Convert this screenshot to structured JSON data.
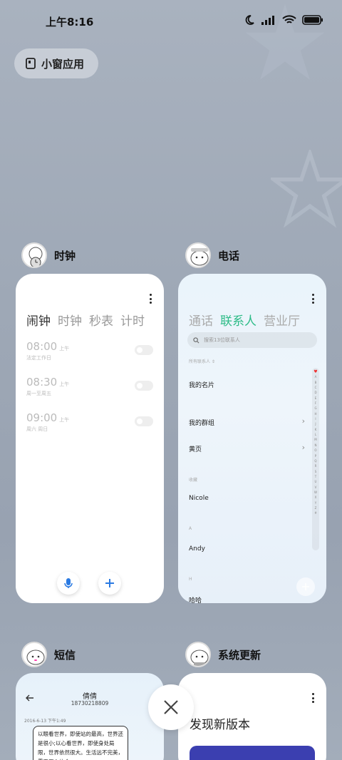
{
  "status": {
    "time": "上午8:16"
  },
  "floating_btn": {
    "label": "小窗应用"
  },
  "apps": [
    {
      "name": "时钟"
    },
    {
      "name": "电话"
    },
    {
      "name": "短信"
    },
    {
      "name": "系统更新"
    }
  ],
  "clock": {
    "tabs": [
      "闹钟",
      "时钟",
      "秒表",
      "计时"
    ],
    "alarms": [
      {
        "time": "08:00",
        "ampm": "上午",
        "desc": "法定工作日"
      },
      {
        "time": "08:30",
        "ampm": "上午",
        "desc": "周一至周五"
      },
      {
        "time": "09:00",
        "ampm": "上午",
        "desc": "周六 周日"
      }
    ]
  },
  "phone": {
    "tabs": [
      "通话",
      "联系人",
      "营业厅"
    ],
    "search_placeholder": "搜索13位联系人",
    "filter": "所有联系人",
    "my_card": "我的名片",
    "groups": "我的群组",
    "yellow": "黄页",
    "fav_header": "收藏",
    "fav1": "Nicole",
    "sec_a": "A",
    "contact_a": "Andy",
    "sec_h": "H",
    "contact_h": "哈哈",
    "alphabet": [
      "♥",
      "A",
      "B",
      "C",
      "D",
      "E",
      "F",
      "G",
      "H",
      "I",
      "J",
      "K",
      "L",
      "M",
      "N",
      "O",
      "P",
      "Q",
      "R",
      "S",
      "T",
      "U",
      "V",
      "W",
      "X",
      "Y",
      "Z",
      "#"
    ]
  },
  "sms": {
    "contact": "倩倩",
    "number": "18730218809",
    "date": "2016-6-13 下午1:49",
    "message": "以眼看世界，即使站的最高，世界还是很小;以心看世界，即使身处局限，世界依然很大。生活远不完美，需要用心体会。"
  },
  "update": {
    "title": "发现新版本"
  },
  "colors": {
    "accent_green": "#2dbb87",
    "accent_blue": "#2a7ae2",
    "update_button": "#3b3fb0"
  }
}
